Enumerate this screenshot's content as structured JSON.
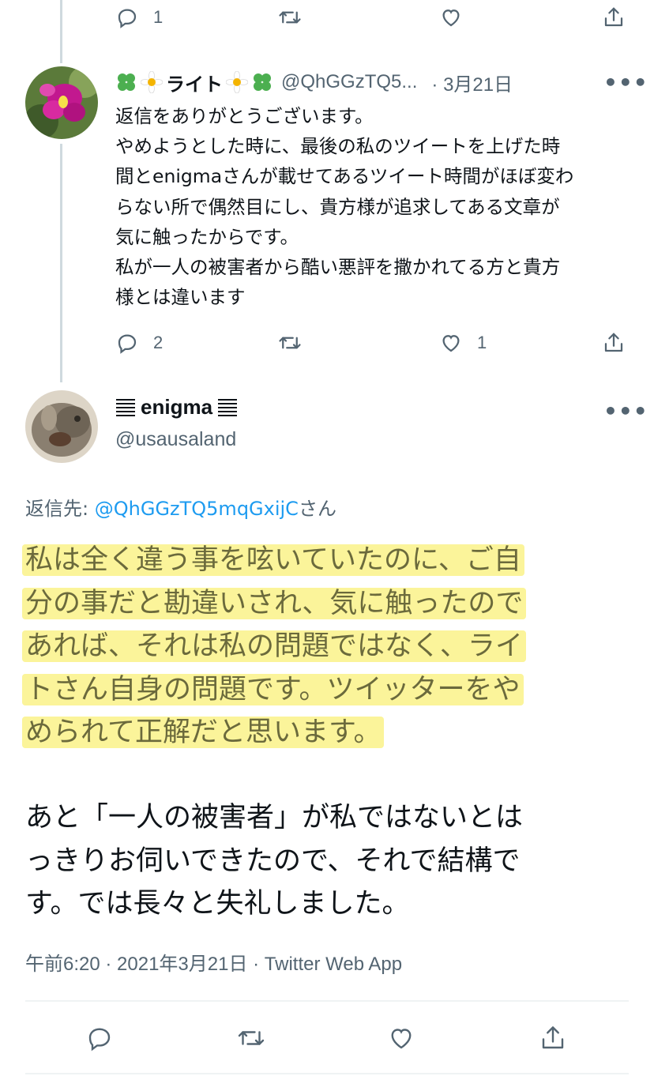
{
  "top_actions": {
    "reply_count": "1"
  },
  "reply_tweet": {
    "name": "ライト",
    "handle": "@QhGGzTQ5...",
    "date": "· 3月21日",
    "more": "•••",
    "body_lines": [
      "返信をありがとうございます。",
      "やめようとした時に、最後の私のツイートを上げた時",
      "間とenigmaさんが載せてあるツイート時間がほぼ変わ",
      "らない所で偶然目にし、貴方様が追求してある文章が",
      "気に触ったからです。",
      "私が一人の被害者から酷い悪評を撒かれてる方と貴方",
      "様とは違います"
    ],
    "reply_count": "2",
    "like_count": "1"
  },
  "main_tweet": {
    "name": "enigma",
    "handle": "@usausaland",
    "more": "•••",
    "replying_prefix": "返信先: ",
    "replying_mention": "@QhGGzTQ5mqGxijC",
    "replying_suffix": "さん",
    "highlighted_lines": [
      "私は全く違う事を呟いていたのに、ご自",
      "分の事だと勘違いされ、気に触ったので",
      "あれば、それは私の問題ではなく、ライ",
      "トさん自身の問題です。ツイッターをや",
      "められて正解だと思います。"
    ],
    "body_lines": [
      "あと「一人の被害者」が私ではないとは",
      "っきりお伺いできたので、それで結構で",
      "す。では長々と失礼しました。"
    ],
    "meta": "午前6:20 · 2021年3月21日 · Twitter Web App"
  },
  "colors": {
    "secondary_text": "#536471",
    "link": "#1d9bf0",
    "highlight": "#fbf49a",
    "thread_line": "#cfd9de"
  }
}
